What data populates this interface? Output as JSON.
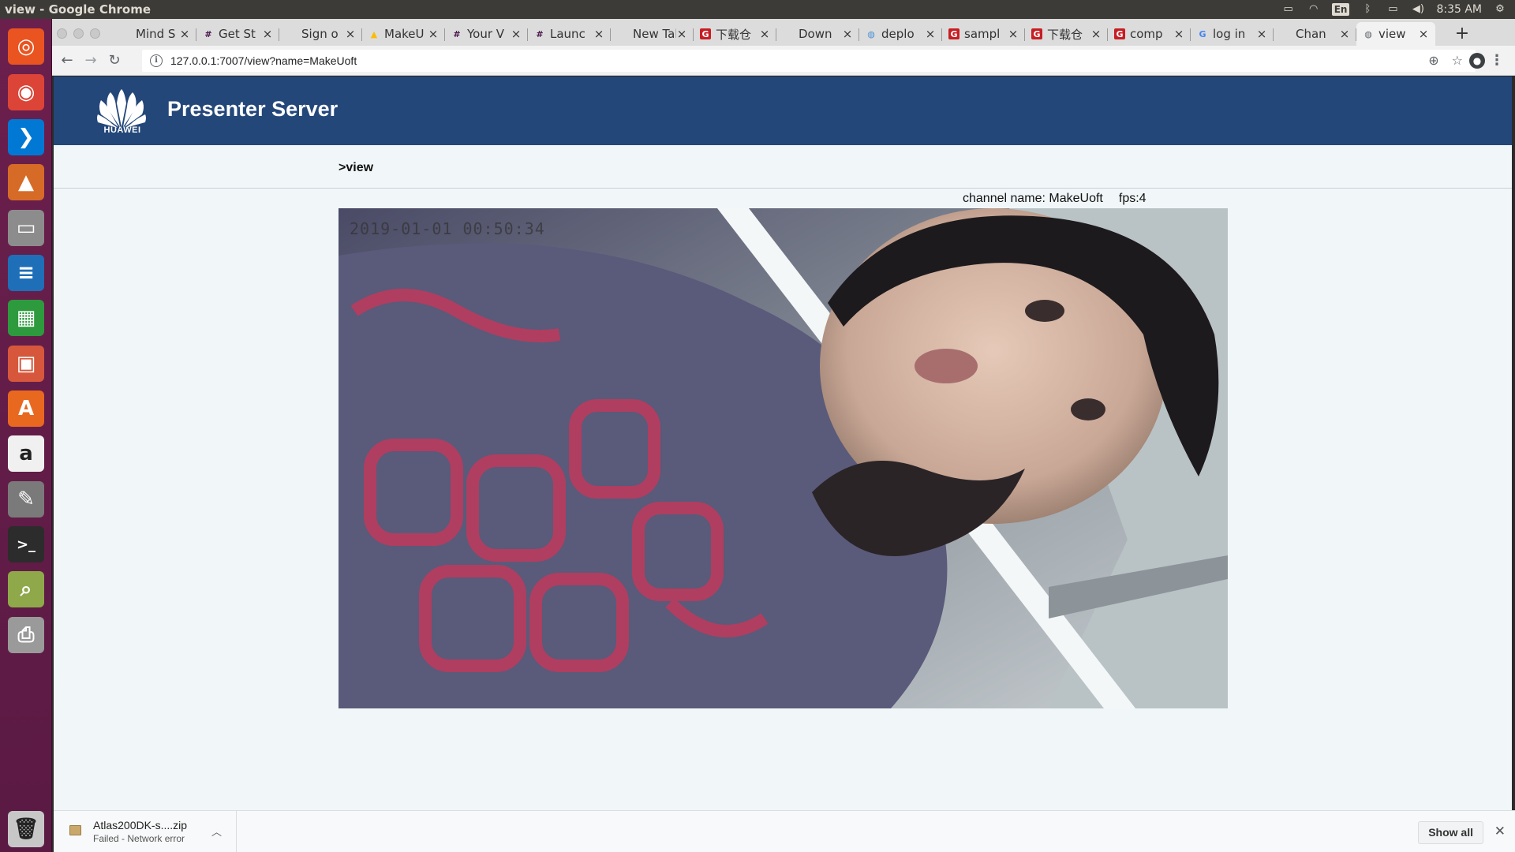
{
  "os": {
    "window_title": "view - Google Chrome",
    "language": "En",
    "clock": "8:35 AM"
  },
  "launcher": {
    "items": [
      {
        "icon": "ubuntu-dash-icon",
        "color": "#e95420"
      },
      {
        "icon": "chrome-icon",
        "color": "#db4437"
      },
      {
        "icon": "vscode-icon",
        "color": "#0078d4"
      },
      {
        "icon": "image-viewer-icon",
        "color": "#d66b27"
      },
      {
        "icon": "file-manager-icon",
        "color": "#8c8c8c"
      },
      {
        "icon": "writer-icon",
        "color": "#1e6fb8"
      },
      {
        "icon": "calc-icon",
        "color": "#2d9a3e"
      },
      {
        "icon": "impress-icon",
        "color": "#d6573c"
      },
      {
        "icon": "software-center-icon",
        "color": "#e9681f"
      },
      {
        "icon": "amazon-icon",
        "color": "#f0f0f0"
      },
      {
        "icon": "settings-icon",
        "color": "#7a7a7a"
      },
      {
        "icon": "terminal-icon",
        "color": "#2c2c2c"
      },
      {
        "icon": "search-tool-icon",
        "color": "#8fa84a"
      },
      {
        "icon": "printer-icon",
        "color": "#9a9a9a"
      },
      {
        "icon": "trash-icon",
        "color": "#c7c7c7"
      }
    ]
  },
  "tabs": [
    {
      "title": "Mind S",
      "favicon": "blank",
      "favicon_color": "#dcdcdc"
    },
    {
      "title": "Get St",
      "favicon": "slack",
      "favicon_color": "#4a154b"
    },
    {
      "title": "Sign o",
      "favicon": "blank",
      "favicon_color": "#dcdcdc"
    },
    {
      "title": "MakeU",
      "favicon": "drive",
      "favicon_color": "#fbbc04"
    },
    {
      "title": "Your V",
      "favicon": "slack",
      "favicon_color": "#4a154b"
    },
    {
      "title": "Launc",
      "favicon": "slack",
      "favicon_color": "#4a154b"
    },
    {
      "title": "New Tab",
      "favicon": "blank",
      "favicon_color": "#dcdcdc"
    },
    {
      "title": "下载仓",
      "favicon": "gitee",
      "favicon_color": "#c71d23"
    },
    {
      "title": "Down",
      "favicon": "blank",
      "favicon_color": "#dcdcdc"
    },
    {
      "title": "deplo",
      "favicon": "globe",
      "favicon_color": "#4a8fd4"
    },
    {
      "title": "sampl",
      "favicon": "gitee",
      "favicon_color": "#c71d23"
    },
    {
      "title": "下载仓",
      "favicon": "gitee",
      "favicon_color": "#c71d23"
    },
    {
      "title": "comp",
      "favicon": "gitee",
      "favicon_color": "#c71d23"
    },
    {
      "title": "log in",
      "favicon": "google",
      "favicon_color": "#4285f4"
    },
    {
      "title": "Chan",
      "favicon": "blank",
      "favicon_color": "#dcdcdc"
    },
    {
      "title": "view",
      "favicon": "globe",
      "favicon_color": "#5f6368",
      "active": true
    }
  ],
  "omnibox": {
    "url": "127.0.0.1:7007/view?name=MakeUoft"
  },
  "page": {
    "logo_text": "HUAWEI",
    "title": "Presenter Server",
    "breadcrumb": ">view",
    "channel_name": "channel name: MakeUoft",
    "fps": "fps:4",
    "video_timestamp": "2019-01-01 00:50:34"
  },
  "colors": {
    "header_bg": "#24477a",
    "page_bg": "#f1f7f9",
    "launcher_bg": "#6b1f4d"
  },
  "downloads": {
    "filename": "Atlas200DK-s....zip",
    "status": "Failed - Network error",
    "show_all_label": "Show all"
  }
}
